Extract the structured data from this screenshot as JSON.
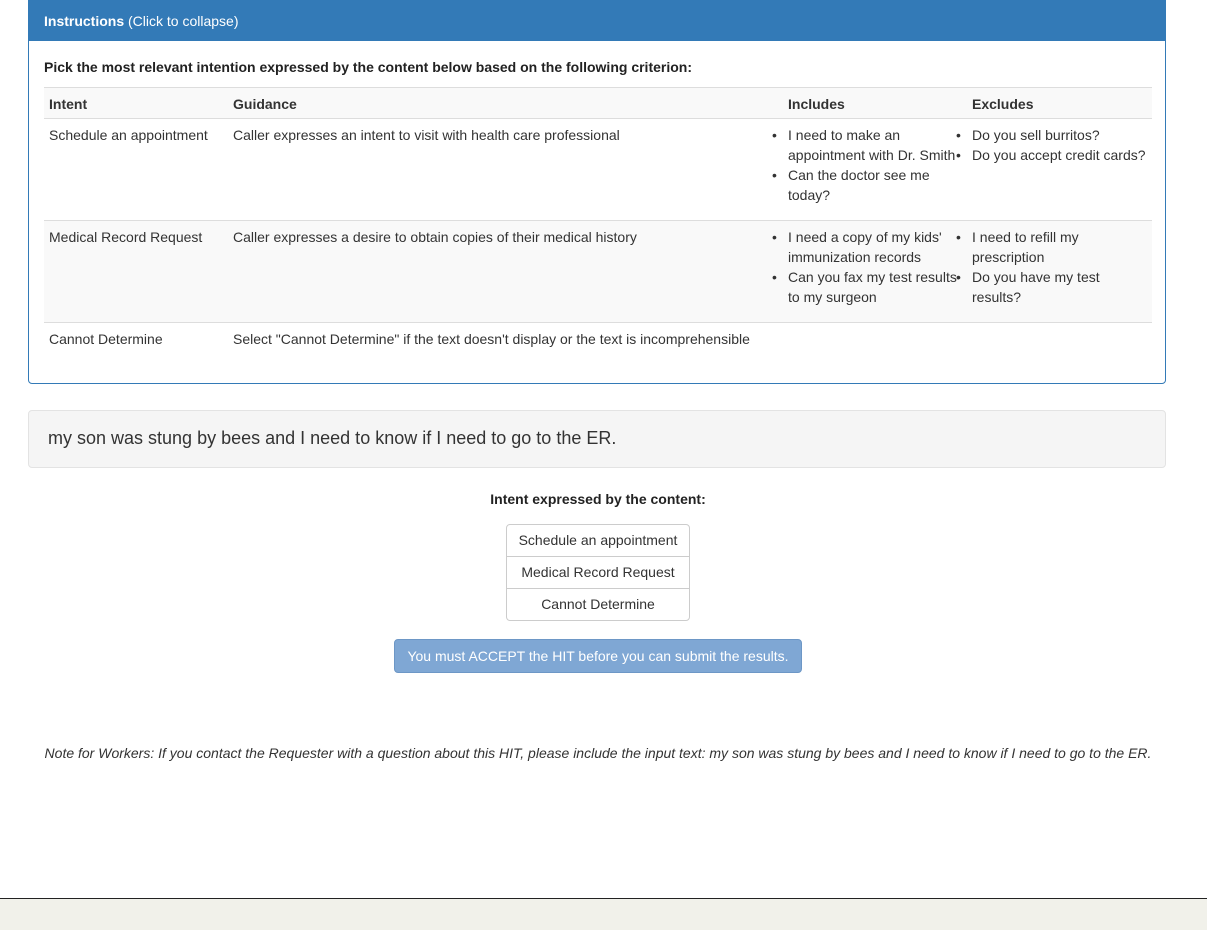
{
  "instructions": {
    "title": "Instructions",
    "toggle_hint": " (Click to collapse)",
    "criterion": "Pick the most relevant intention expressed by the content below based on the following criterion:",
    "table": {
      "headers": [
        "Intent",
        "Guidance",
        "Includes",
        "Excludes"
      ],
      "rows": [
        {
          "intent": "Schedule an appointment",
          "guidance": "Caller expresses an intent to visit with health care professional",
          "includes": [
            "I need to make an appointment with Dr. Smith",
            "Can the doctor see me today?"
          ],
          "excludes": [
            "Do you sell burritos?",
            "Do you accept credit cards?"
          ]
        },
        {
          "intent": "Medical Record Request",
          "guidance": "Caller expresses a desire to obtain copies of their medical history",
          "includes": [
            "I need a copy of my kids' immunization records",
            "Can you fax my test results to my surgeon"
          ],
          "excludes": [
            "I need to refill my prescription",
            "Do you have my test results?"
          ]
        },
        {
          "intent": "Cannot Determine",
          "guidance": "Select \"Cannot Determine\" if the text doesn't display or the text is incomprehensible",
          "includes": [],
          "excludes": []
        }
      ]
    }
  },
  "content_text": "my son was stung by bees and I need to know if I need to go to the ER.",
  "intent_prompt": "Intent expressed by the content:",
  "options": [
    "Schedule an appointment",
    "Medical Record Request",
    "Cannot Determine"
  ],
  "submit_label": "You must ACCEPT the HIT before you can submit the results.",
  "note": "Note for Workers: If you contact the Requester with a question about this HIT, please include the input text: my son was stung by bees and I need to know if I need to go to the ER.",
  "colors": {
    "panel_primary": "#337ab7",
    "submit_disabled": "#7fa7d4"
  }
}
